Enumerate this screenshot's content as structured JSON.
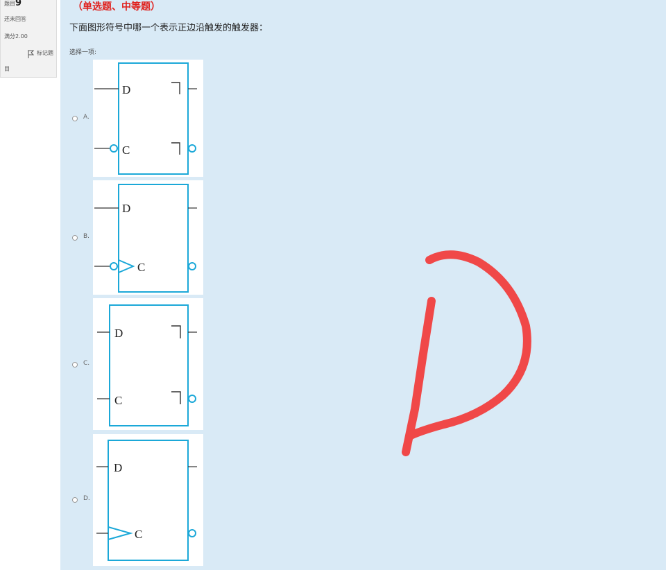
{
  "question_info": {
    "number_prefix": "题目",
    "number": "9",
    "status": "还未回答",
    "score": "满分2.00",
    "flag_label_part1": "标记题",
    "flag_label_part2": "目"
  },
  "question": {
    "type": "（单选题、中等题）",
    "text": "下面图形符号中哪一个表示正边沿触发的触发器：",
    "prompt": "选择一项:"
  },
  "options": [
    {
      "label": "A.",
      "pin_d": "D",
      "pin_c": "C"
    },
    {
      "label": "B.",
      "pin_d": "D",
      "pin_c": "C"
    },
    {
      "label": "C.",
      "pin_d": "D",
      "pin_c": "C"
    },
    {
      "label": "D.",
      "pin_d": "D",
      "pin_c": "C"
    }
  ],
  "colors": {
    "symbol_stroke": "#1ba8d8",
    "question_type": "#e0201c",
    "handwriting": "#f04848",
    "question_bg": "#d9eaf6"
  },
  "icons": {
    "flag": "flag-icon",
    "radio": "radio-button"
  }
}
